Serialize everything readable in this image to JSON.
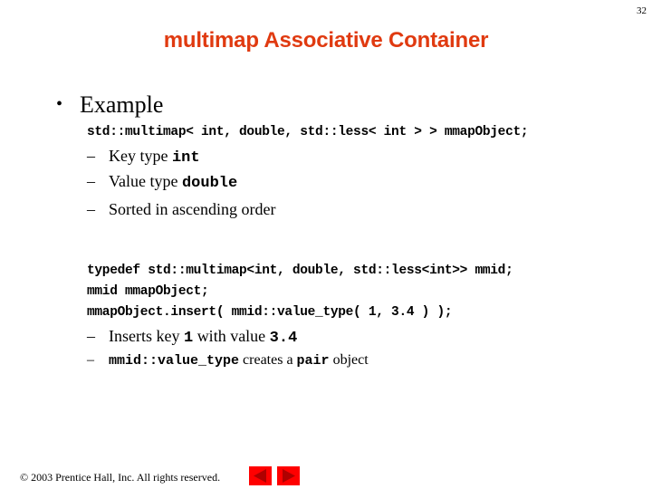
{
  "slide": {
    "page_number": "32",
    "title": "multimap Associative Container",
    "bullet": {
      "symbol": "•",
      "text": "Example"
    },
    "code_example_1": "std::multimap< int, double, std::less< int > > mmapObject;",
    "subpoints_1": [
      {
        "dash": "–",
        "text": "Key type ",
        "code": "int"
      },
      {
        "dash": "–",
        "text": "Value type ",
        "code": "double"
      },
      {
        "dash": "–",
        "text": "Sorted in ascending order",
        "code": ""
      }
    ],
    "code_example_2": [
      "typedef std::multimap<int, double, std::less<int>> mmid;",
      "mmid mmapObject;",
      "mmapObject.insert( mmid::value_type( 1, 3.4 ) );"
    ],
    "subpoints_2": [
      {
        "dash": "–",
        "text_before": "Inserts key ",
        "code1": "1",
        "text_mid": " with value ",
        "code2": "3.4"
      },
      {
        "dash": "–",
        "code1": "mmid::value_type",
        "text_mid": " creates a ",
        "code2": "pair",
        "text_after": " object"
      }
    ],
    "footer": "© 2003 Prentice Hall, Inc.  All rights reserved.",
    "nav": {
      "prev_icon": "triangle-left-icon",
      "next_icon": "triangle-right-icon",
      "button_color": "#ff0000",
      "arrow_color": "#b00000"
    },
    "title_color": "#e03a10"
  }
}
